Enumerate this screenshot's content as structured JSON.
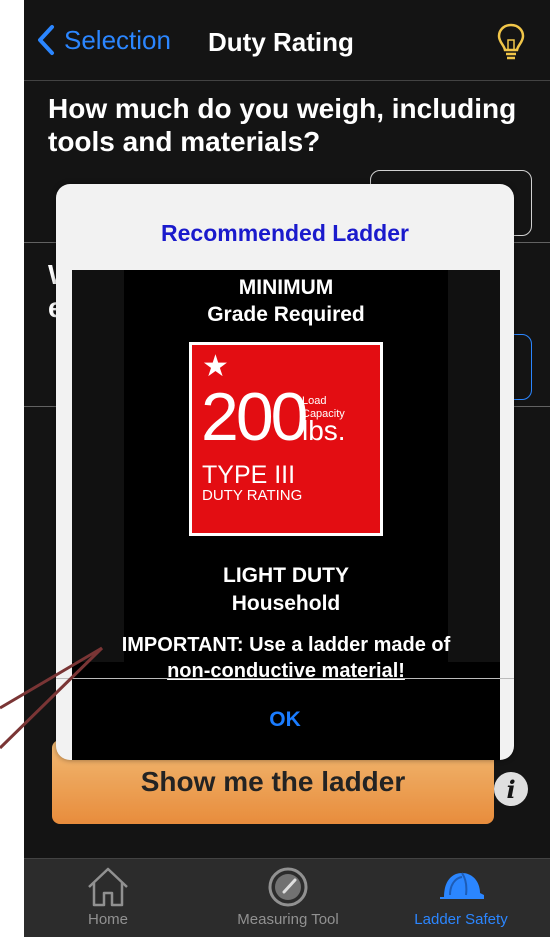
{
  "navbar": {
    "back_label": "Selection",
    "title": "Duty Rating",
    "right_icon": "lightbulb-icon"
  },
  "question": {
    "text": "How much do you weigh, including tools and materials?",
    "input_value": ""
  },
  "question2": {
    "partial_text_line1": "W",
    "partial_text_line2": "e",
    "input_value": ""
  },
  "show_button": {
    "label": "Show me the ladder"
  },
  "info_button": {
    "icon": "info-icon",
    "glyph": "i"
  },
  "tabbar": {
    "tabs": [
      {
        "label": "Home",
        "icon": "home-icon",
        "active": false
      },
      {
        "label": "Measuring Tool",
        "icon": "gauge-icon",
        "active": false
      },
      {
        "label": "Ladder Safety",
        "icon": "hard-hat-icon",
        "active": true
      }
    ]
  },
  "alert": {
    "title": "Recommended Ladder",
    "min_line1": "MINIMUM",
    "min_line2": "Grade Required",
    "badge": {
      "star": "★",
      "capacity": "200",
      "capacity_label": "Load Capacity",
      "capacity_unit": "lbs.",
      "type": "TYPE III",
      "rating_label": "DUTY RATING"
    },
    "duty_line1": "LIGHT DUTY",
    "duty_line2": "Household",
    "important_line1": "IMPORTANT: Use a ladder made of",
    "important_line2": "non-conductive material!",
    "ok_label": "OK"
  },
  "colors": {
    "accent": "#1a7cff",
    "alert_title": "#1a1acc",
    "badge_red": "#e30d12",
    "button_orange": "#e7832c",
    "bulb_yellow": "#f0c23a",
    "callout": "#7a3535"
  }
}
